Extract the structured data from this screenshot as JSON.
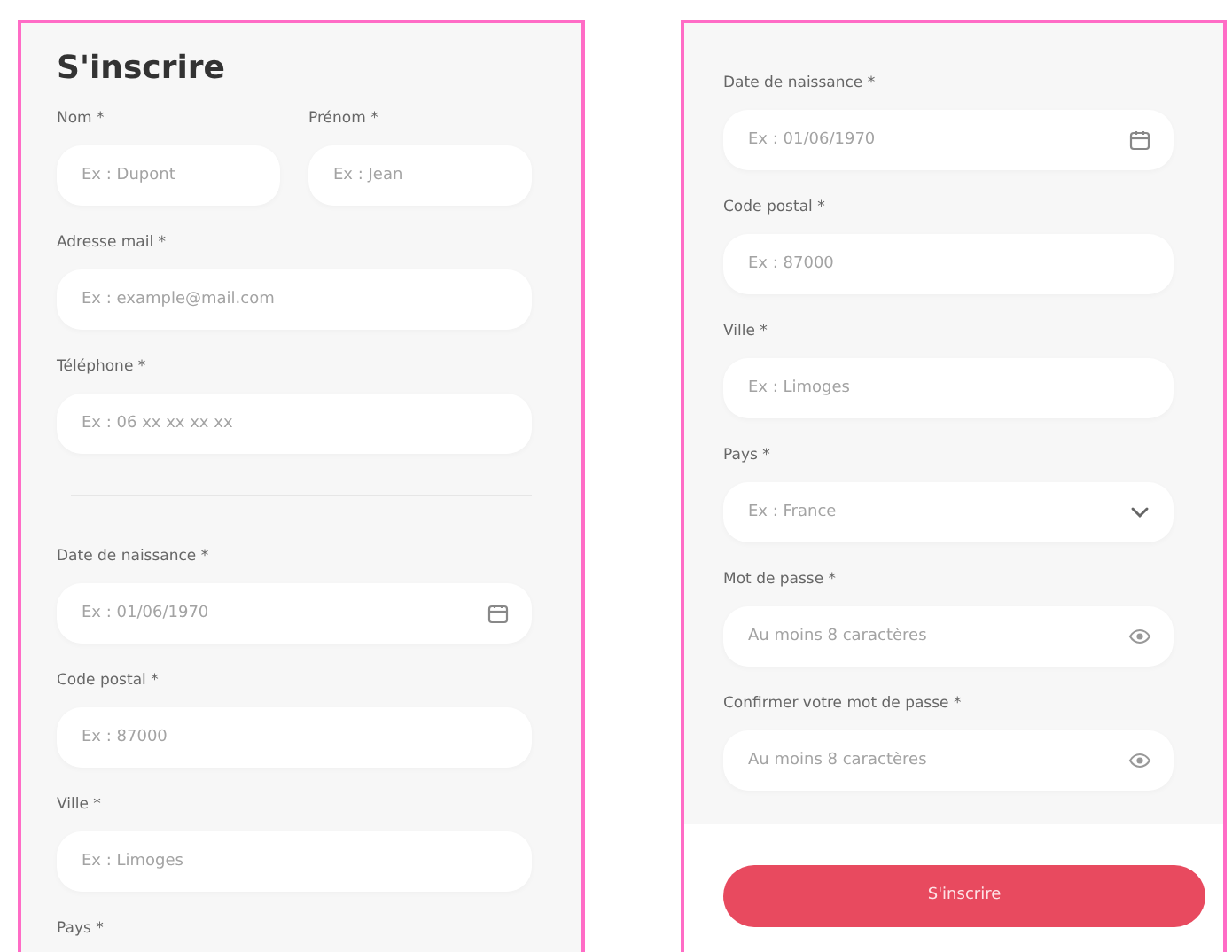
{
  "screens": [
    {
      "title": "S'inscrire",
      "items": [
        {
          "kind": "pair",
          "fields": [
            {
              "kind": "text",
              "label": "Nom *",
              "placeholder": "Ex : Dupont"
            },
            {
              "kind": "text",
              "label": "Prénom *",
              "placeholder": "Ex : Jean"
            }
          ]
        },
        {
          "kind": "text",
          "label": "Adresse mail *",
          "placeholder": "Ex : example@mail.com"
        },
        {
          "kind": "text",
          "label": "Téléphone *",
          "placeholder": "Ex : 06 xx xx xx xx"
        },
        {
          "kind": "divider"
        },
        {
          "kind": "date",
          "label": "Date de naissance *",
          "placeholder": "Ex : 01/06/1970"
        },
        {
          "kind": "text",
          "label": "Code postal *",
          "placeholder": "Ex : 87000"
        },
        {
          "kind": "text",
          "label": "Ville *",
          "placeholder": "Ex : Limoges"
        },
        {
          "kind": "label",
          "label": "Pays *"
        }
      ]
    },
    {
      "items": [
        {
          "kind": "date",
          "label": "Date de naissance *",
          "placeholder": "Ex : 01/06/1970"
        },
        {
          "kind": "text",
          "label": "Code postal *",
          "placeholder": "Ex : 87000"
        },
        {
          "kind": "text",
          "label": "Ville *",
          "placeholder": "Ex : Limoges"
        },
        {
          "kind": "select",
          "label": "Pays *",
          "placeholder": "Ex : France"
        },
        {
          "kind": "password",
          "label": "Mot de passe *",
          "placeholder": "Au moins 8 caractères"
        },
        {
          "kind": "password",
          "label": "Confirmer votre mot de passe *",
          "placeholder": "Au moins 8 caractères"
        }
      ],
      "button": "S'inscrire"
    }
  ]
}
